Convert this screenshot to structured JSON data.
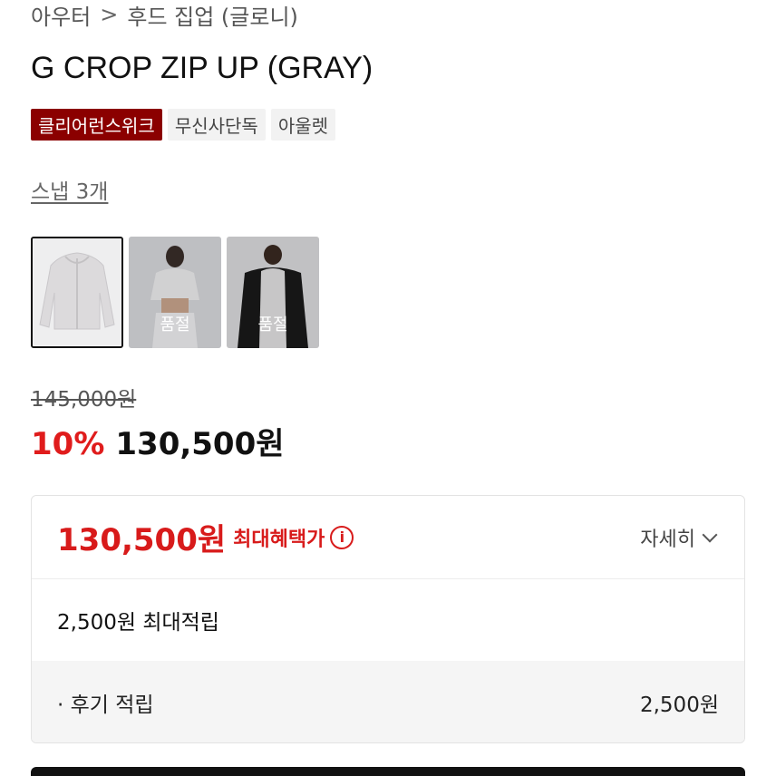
{
  "breadcrumb": {
    "items": [
      "아우터",
      "후드 집업 (글로니)"
    ],
    "separator": ">"
  },
  "product": {
    "title": "G CROP ZIP UP (GRAY)"
  },
  "badges": [
    {
      "label": "클리어런스위크",
      "color": "#8b0000"
    },
    {
      "label": "무신사단독"
    },
    {
      "label": "아울렛"
    }
  ],
  "snap_link": "스냅 3개",
  "thumbnails": [
    {
      "selected": true,
      "status": ""
    },
    {
      "selected": false,
      "status": "품절"
    },
    {
      "selected": false,
      "status": "품절"
    }
  ],
  "price": {
    "original": "145,000원",
    "discount": "10%",
    "sale": "130,500원"
  },
  "benefit": {
    "max_price": "130,500원",
    "max_label": "최대혜택가",
    "info_icon": "info-icon",
    "detail_label": "자세히",
    "points_label": "2,500원 최대적립",
    "review_label": "· 후기 적립",
    "review_value": "2,500원"
  },
  "colors": {
    "accent_red": "#d81b1b",
    "badge_dark_red": "#8b0000"
  }
}
